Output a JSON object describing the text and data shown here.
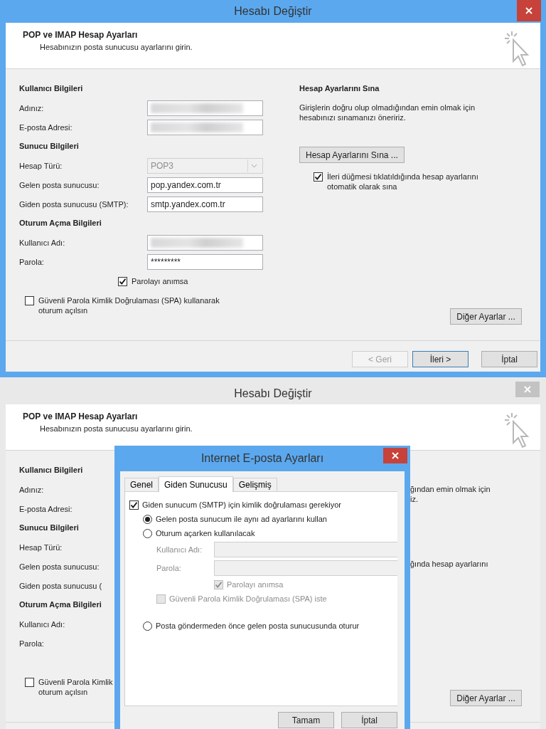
{
  "windows": [
    {
      "title": "Hesabı Değiştir",
      "active": true,
      "header": {
        "title": "POP ve IMAP Hesap Ayarları",
        "subtitle": "Hesabınızın posta sunucusu ayarlarını girin."
      },
      "left": [
        {
          "kind": "heading",
          "text": "Kullanıcı Bilgileri"
        },
        {
          "kind": "field",
          "label": "Adınız:",
          "blurred": true
        },
        {
          "kind": "field",
          "label": "E-posta Adresi:",
          "blurred": true
        },
        {
          "kind": "heading",
          "text": "Sunucu Bilgileri"
        },
        {
          "kind": "select",
          "label": "Hesap Türü:",
          "value": "POP3",
          "disabled": true
        },
        {
          "kind": "field",
          "label": "Gelen posta sunucusu:",
          "value": "pop.yandex.com.tr"
        },
        {
          "kind": "field",
          "label": "Giden posta sunucusu (SMTP):",
          "value": "smtp.yandex.com.tr"
        },
        {
          "kind": "heading",
          "text": "Oturum Açma Bilgileri"
        },
        {
          "kind": "field",
          "label": "Kullanıcı Adı:",
          "blurred": true
        },
        {
          "kind": "field",
          "label": "Parola:",
          "value": "*********"
        },
        {
          "kind": "check",
          "lines": [
            "Parolayı anımsa"
          ],
          "checked": true
        }
      ],
      "right": [
        {
          "kind": "heading",
          "text": "Hesap Ayarlarını Sına"
        },
        {
          "kind": "paragraph",
          "lines": [
            "Girişlerin doğru olup olmadığından emin olmak için",
            "hesabınızı sınamanızı öneririz."
          ]
        },
        {
          "kind": "button",
          "label": "Hesap Ayarlarını Sına ..."
        },
        {
          "kind": "check",
          "lines": [
            "İleri düğmesi tıklatıldığında hesap ayarlarını",
            "otomatik olarak sına"
          ],
          "checked": true
        }
      ],
      "spa_check": {
        "lines": [
          "Güvenli Parola Kimlik Doğrulaması (SPA) kullanarak",
          "oturum açılsın"
        ],
        "checked": false
      },
      "more_button": "Diğer Ayarlar ...",
      "footer_buttons": [
        {
          "label": "< Geri",
          "disabled": true,
          "default": false
        },
        {
          "label": "İleri >",
          "disabled": false,
          "default": true
        },
        {
          "label": "İptal",
          "disabled": false,
          "default": false
        }
      ]
    },
    {
      "title": "Hesabı Değiştir",
      "active": false,
      "header": {
        "title": "POP ve IMAP Hesap Ayarları",
        "subtitle": "Hesabınızın posta sunucusu ayarlarını girin."
      },
      "left": [
        {
          "kind": "heading",
          "text": "Kullanıcı Bilgileri"
        },
        {
          "kind": "label",
          "text": "Adınız:"
        },
        {
          "kind": "label",
          "text": "E-posta Adresi:"
        },
        {
          "kind": "heading",
          "text": "Sunucu Bilgileri"
        },
        {
          "kind": "label",
          "text": "Hesap Türü:"
        },
        {
          "kind": "label",
          "text": "Gelen posta sunucusu:"
        },
        {
          "kind": "label",
          "text": "Giden posta sunucusu ("
        },
        {
          "kind": "heading",
          "text": "Oturum Açma Bilgileri"
        },
        {
          "kind": "label",
          "text": "Kullanıcı Adı:"
        },
        {
          "kind": "label",
          "text": "Parola:"
        }
      ],
      "right": [
        {
          "kind": "fragment",
          "lines": [
            "ğından emin olmak için",
            "iz."
          ]
        },
        {
          "kind": "fragment",
          "lines": [
            "ğında hesap ayarlarını"
          ]
        }
      ],
      "spa_check": {
        "lines": [
          "Güvenli Parola Kimlik",
          "oturum açılsın"
        ],
        "checked": false
      },
      "more_button": "Diğer Ayarlar ...",
      "dialog": {
        "title": "Internet E-posta Ayarları",
        "tabs": [
          {
            "label": "Genel",
            "selected": false
          },
          {
            "label": "Giden Sunucusu",
            "selected": true
          },
          {
            "label": "Gelişmiş",
            "selected": false
          }
        ],
        "items": [
          {
            "kind": "check",
            "label": "Giden sunucum (SMTP) için kimlik doğrulaması gerekiyor",
            "checked": true,
            "disabled": false,
            "children": [
              {
                "kind": "radio",
                "label": "Gelen posta sunucum ile aynı ad ayarlarını kullan",
                "selected": true
              },
              {
                "kind": "radio",
                "label": "Oturum açarken kullanılacak",
                "selected": false,
                "children": [
                  {
                    "kind": "field",
                    "label": "Kullanıcı Adı:",
                    "disabled": true
                  },
                  {
                    "kind": "field",
                    "label": "Parola:",
                    "disabled": true
                  },
                  {
                    "kind": "field_check",
                    "label": "Parolayı anımsa",
                    "checked": true,
                    "disabled": true
                  },
                  {
                    "kind": "check",
                    "label": "Güvenli Parola Kimlik Doğrulaması (SPA) iste",
                    "checked": false,
                    "disabled": true
                  }
                ]
              },
              {
                "kind": "radio",
                "label": "Posta göndermeden önce gelen posta sunucusunda oturur",
                "selected": false
              }
            ]
          }
        ],
        "buttons": [
          "Tamam",
          "İptal"
        ]
      }
    }
  ]
}
